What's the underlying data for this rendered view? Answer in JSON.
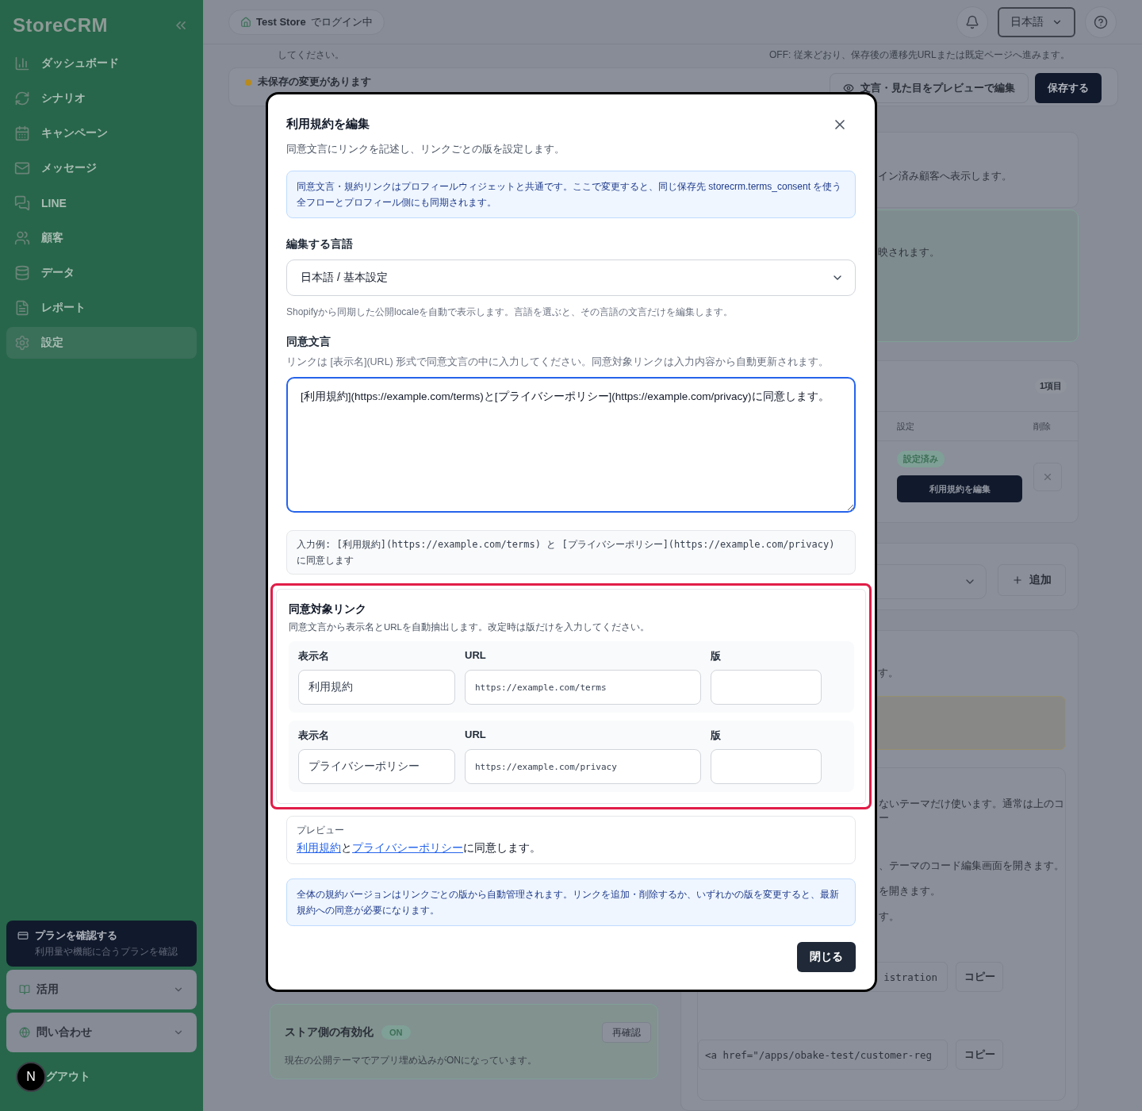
{
  "sidebar": {
    "logo": "StoreCRM",
    "items": [
      {
        "label": "ダッシュボード",
        "selected": false
      },
      {
        "label": "シナリオ",
        "selected": false
      },
      {
        "label": "キャンペーン",
        "selected": false
      },
      {
        "label": "メッセージ",
        "selected": false
      },
      {
        "label": "LINE",
        "selected": false
      },
      {
        "label": "顧客",
        "selected": false
      },
      {
        "label": "データ",
        "selected": false
      },
      {
        "label": "レポート",
        "selected": false
      },
      {
        "label": "設定",
        "selected": true
      }
    ],
    "plan": {
      "title": "プランを確認する",
      "subtitle": "利用量や機能に合うプランを確認"
    },
    "sections": [
      {
        "label": "活用",
        "expanded": false
      },
      {
        "label": "問い合わせ",
        "expanded": false
      }
    ],
    "logout": "グアウト",
    "dev_badge": "N"
  },
  "topbar": {
    "store": "Test Store",
    "store_suffix": "でログイン中",
    "language": "日本語"
  },
  "background": {
    "notice_tail": "してください。",
    "off_note": "OFF: 従来どおり、保存後の遷移先URLまたは既定ページへ進みます。",
    "unsaved": "未保存の変更があります",
    "preview_button": "文言・見た目をプレビューで編集",
    "save_button": "保存する",
    "card_fragment": "イン済み顧客へ表示します。",
    "green_fragment": "映されます。",
    "table": {
      "count": "1項目",
      "columns": [
        "設定",
        "削除"
      ],
      "status": "設定済み",
      "edit_button": "利用規約を編集"
    },
    "add_button": "追加",
    "fragment_3": "す。",
    "theme_lines": [
      "ないテーマだけ使います。通常は上のコー",
      "、テーマのコード編集画面を開きます。",
      "を開きます。",
      "す。"
    ],
    "code_fields": [
      {
        "value": "istration",
        "copy": "コピー"
      },
      {
        "value": "<a href=\"/apps/obake-test/customer-reg",
        "copy": "コピー"
      }
    ],
    "store_card": {
      "title": "ストア側の有効化",
      "status": "ON",
      "recheck": "再確認",
      "note": "現在の公開テーマでアプリ埋め込みがONになっています。"
    }
  },
  "modal": {
    "title": "利用規約を編集",
    "subtitle": "同意文言にリンクを記述し、リンクごとの版を設定します。",
    "info": "同意文言・規約リンクはプロフィールウィジェットと共通です。ここで変更すると、同じ保存先 storecrm.terms_consent を使う全フローとプロフィール側にも同期されます。",
    "language_label": "編集する言語",
    "language_value": "日本語 / 基本設定",
    "language_hint": "Shopifyから同期した公開localeを自動で表示します。言語を選ぶと、その言語の文言だけを編集します。",
    "consent_label": "同意文言",
    "consent_hint": "リンクは [表示名](URL) 形式で同意文言の中に入力してください。同意対象リンクは入力内容から自動更新されます。",
    "consent_value": "[利用規約](https://example.com/terms)と[プライバシーポリシー](https://example.com/privacy)に同意します。",
    "example": "入力例: [利用規約](https://example.com/terms) と [プライバシーポリシー](https://example.com/privacy) に同意します",
    "links": {
      "highlighted": true,
      "title": "同意対象リンク",
      "description": "同意文言から表示名とURLを自動抽出します。改定時は版だけを入力してください。",
      "rows": [
        {
          "headers": [
            "表示名",
            "URL",
            "版"
          ],
          "name": "利用規約",
          "url": "https://example.com/terms"
        },
        {
          "headers": [
            "表示名",
            "URL",
            "版"
          ],
          "name": "プライバシーポリシー",
          "url": "https://example.com/privacy"
        }
      ]
    },
    "preview": {
      "label": "プレビュー",
      "parts": [
        {
          "text": "利用規約",
          "link": true
        },
        {
          "text": "と",
          "link": false
        },
        {
          "text": "プライバシーポリシー",
          "link": true
        },
        {
          "text": "に同意します。",
          "link": false
        }
      ]
    },
    "version_note": "全体の規約バージョンはリンクごとの版から自動管理されます。リンクを追加・削除するか、いずれかの版を変更すると、最新規約への同意が必要になります。",
    "close_button": "閉じる"
  }
}
